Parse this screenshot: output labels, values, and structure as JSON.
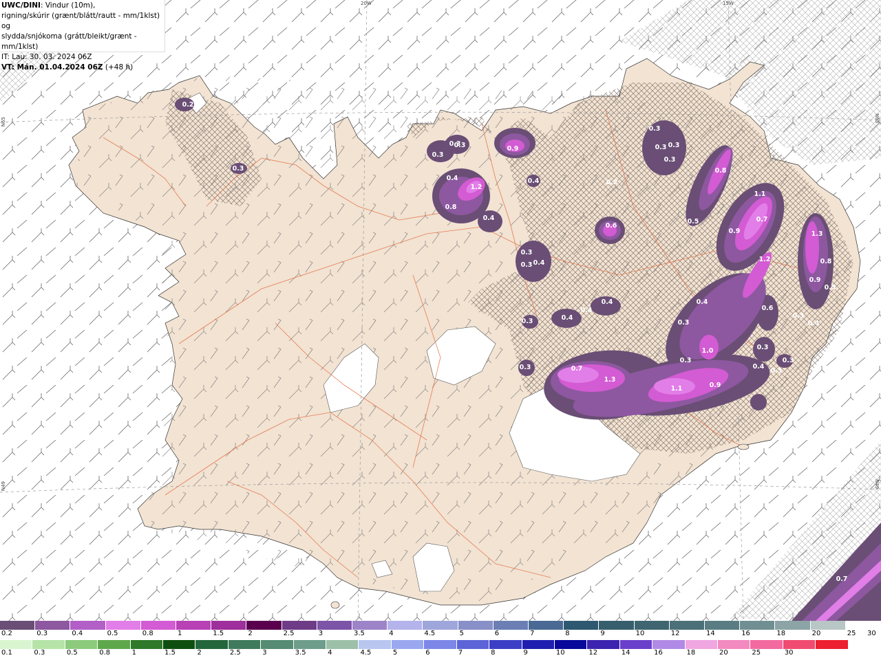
{
  "header": {
    "model": "UWC/DINI",
    "description_line1": ": Vindur (10m),",
    "description_line2": "rigning/skúrir (grænt/blátt/rautt - mm/1klst) og",
    "description_line3": "slydda/snjókoma (grátt/bleikt/grænt - mm/1klst)",
    "initial_time": "IT: Lau. 30. 03. 2024 06Z",
    "valid_time_bold": "VT: Mán. 01.04.2024 06Z",
    "valid_offset": "(+48 h)"
  },
  "grid_labels": {
    "lon_20w": "20W",
    "lon_15w": "15W",
    "lat_65n_left": "N65",
    "lat_65n_right": "N65",
    "lat_64n_left": "N49",
    "lat_64n_right": "N49"
  },
  "precip_values": [
    {
      "label": "0.2"
    },
    {
      "label": "0.3"
    },
    {
      "label": "0.3"
    },
    {
      "label": "0.3"
    },
    {
      "label": "0.3"
    },
    {
      "label": "0.4"
    },
    {
      "label": "0.4"
    },
    {
      "label": "1.2"
    },
    {
      "label": "0.8"
    },
    {
      "label": "0.9"
    },
    {
      "label": "0.3"
    },
    {
      "label": "0.3"
    },
    {
      "label": "0.3"
    },
    {
      "label": "0.3"
    },
    {
      "label": "0.8"
    },
    {
      "label": "0.2"
    },
    {
      "label": "0.5"
    },
    {
      "label": "1.1"
    },
    {
      "label": "0.7"
    },
    {
      "label": "0.9"
    },
    {
      "label": "1.3"
    },
    {
      "label": "1.2"
    },
    {
      "label": "0.8"
    },
    {
      "label": "0.9"
    },
    {
      "label": "0.5"
    },
    {
      "label": "0.4"
    },
    {
      "label": "0.3"
    },
    {
      "label": "0.4"
    },
    {
      "label": "0.6"
    },
    {
      "label": "0.4"
    },
    {
      "label": "0.3"
    },
    {
      "label": "0.3"
    },
    {
      "label": "0.4"
    },
    {
      "label": "0.4"
    },
    {
      "label": "0.3"
    },
    {
      "label": "0.4"
    },
    {
      "label": "0.3"
    },
    {
      "label": "0.7"
    },
    {
      "label": "1.3"
    },
    {
      "label": "1.1"
    },
    {
      "label": "0.9"
    },
    {
      "label": "1.0"
    },
    {
      "label": "0.3"
    },
    {
      "label": "0.4"
    },
    {
      "label": "0.3"
    },
    {
      "label": "0.3"
    },
    {
      "label": "0.4"
    },
    {
      "label": "0.3"
    },
    {
      "label": "0.3"
    },
    {
      "label": "0.6"
    },
    {
      "label": "0.7"
    }
  ],
  "legend_snow": {
    "colors": [
      "#6a4e75",
      "#8d58a0",
      "#b35fc8",
      "#e27ee8",
      "#d35bd3",
      "#b841b6",
      "#9e2f9c",
      "#5a004f",
      "#6e3b86",
      "#7c54a8",
      "#9d83c8",
      "#b5b3ec",
      "#9fa6dc",
      "#8890c7",
      "#6b7fb5",
      "#4a6a95",
      "#2e5870",
      "#375e6c",
      "#3f6670",
      "#4b7078",
      "#5a7d83",
      "#708f92",
      "#8ca4a5",
      "#b8c6c6"
    ],
    "labels": [
      "0.2",
      "0.3",
      "0.4",
      "0.5",
      "0.8",
      "1",
      "1.5",
      "2",
      "2.5",
      "3",
      "3.5",
      "4",
      "4.5",
      "5",
      "6",
      "7",
      "8",
      "9",
      "10",
      "12",
      "14",
      "16",
      "18",
      "20",
      "25",
      "30"
    ]
  },
  "legend_rain": {
    "colors": [
      "#d8f5d0",
      "#b6e4a8",
      "#8ccb7c",
      "#5ea84c",
      "#2f7a2a",
      "#0e4f10",
      "#24663c",
      "#3f7a5c",
      "#558c73",
      "#6e9d8b",
      "#9cc0a8",
      "#b9c6f0",
      "#9aa8f0",
      "#7c87e8",
      "#5d64d8",
      "#3c3fc6",
      "#1e1fb0",
      "#08089a",
      "#3c23b0",
      "#6a3fcb",
      "#b08ae6",
      "#f0a6e0",
      "#f38ac0",
      "#f36aa0",
      "#f04b70",
      "#ec2030"
    ],
    "labels": [
      "0.1",
      "0.3",
      "0.5",
      "0.8",
      "1",
      "1.5",
      "2",
      "2.5",
      "3",
      "3.5",
      "4",
      "4.5",
      "5",
      "6",
      "7",
      "8",
      "9",
      "10",
      "12",
      "14",
      "16",
      "18",
      "20",
      "25",
      "30"
    ]
  }
}
